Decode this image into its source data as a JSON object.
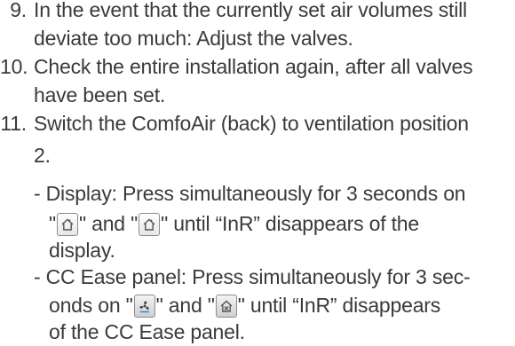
{
  "steps": [
    {
      "number": "9.",
      "lines": [
        "In the event that the currently set air volumes still",
        "deviate too much: Adjust the valves."
      ]
    },
    {
      "number": "10.",
      "lines": [
        "Check the entire installation again, after all valves",
        "have been set."
      ]
    },
    {
      "number": "11.",
      "lines": [
        "Switch the ComfoAir (back) to ventilation position",
        "2."
      ]
    }
  ],
  "substeps": {
    "display": {
      "line1": "- Display: Press simultaneously for 3 seconds on",
      "q1_open": "\"",
      "q1_close": "\" and \"",
      "q2_close": "\" until “InR” disappears of the",
      "line3": "display."
    },
    "panel": {
      "line1": "- CC Ease panel: Press simultaneously for 3 sec-",
      "prefix": "onds on \"",
      "mid": "\" and \"",
      "suffix": "\" until “InR” disappears",
      "line3": "of the CC Ease panel."
    }
  },
  "icons": {
    "display_first": "home-icon",
    "display_second": "home-icon",
    "panel_first": "fan-icon",
    "panel_second": "away-icon"
  }
}
